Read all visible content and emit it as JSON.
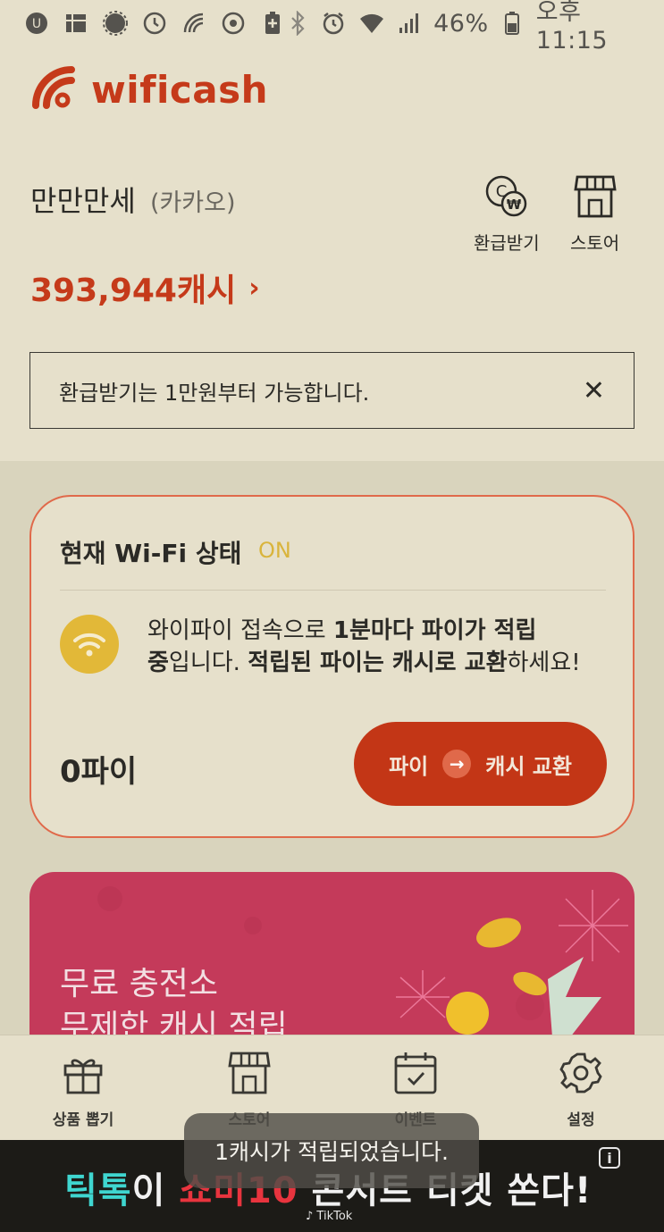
{
  "status_bar": {
    "left_icons": [
      "notification-u-icon",
      "grid-app-icon",
      "badge-icon",
      "clock-app-icon",
      "wifi-app-icon",
      "vpn-icon",
      "battery-saver-icon"
    ],
    "right_icons": [
      "bluetooth-icon",
      "alarm-icon",
      "wifi-icon",
      "signal-icon"
    ],
    "battery": "46%",
    "time": "오후 11:15"
  },
  "app": {
    "logo_text": "wificash"
  },
  "user": {
    "name": "만만만세",
    "provider": "(카카오)"
  },
  "cash": {
    "amount": "393,944캐시",
    "chevron": "›"
  },
  "shortcuts": [
    {
      "label": "환급받기",
      "icon": "refund-coin-icon"
    },
    {
      "label": "스토어",
      "icon": "store-icon"
    }
  ],
  "notice": {
    "text": "환급받기는 1만원부터 가능합니다.",
    "close": "✕"
  },
  "wifi_card": {
    "title": "현재 Wi-Fi 상태",
    "status": "ON",
    "desc_1a": "와이파이 접속으로 ",
    "desc_1b": "1분마다 파이가 적립",
    "desc_2a": "중",
    "desc_2b": "입니다. ",
    "desc_2c": "적립된 파이는 캐시로 교환",
    "desc_2d": "하세요!",
    "pie_count": "0파이",
    "exchange_from": "파이",
    "exchange_to": "캐시 교환"
  },
  "banner": {
    "line1": "무료 충전소",
    "line2": "무제한 캐시 적립"
  },
  "bottom_nav": [
    {
      "label": "상품 뽑기",
      "icon": "gift-icon"
    },
    {
      "label": "스토어",
      "icon": "store-icon"
    },
    {
      "label": "이벤트",
      "icon": "calendar-check-icon"
    },
    {
      "label": "설정",
      "icon": "gear-icon"
    }
  ],
  "ad": {
    "part1": "틱톡",
    "part2": "이 ",
    "part3": "쇼미10",
    "part4": " 콘서트 티켓 쏜다!",
    "source": "♪ TikTok",
    "info": "i"
  },
  "toast": {
    "text": "1캐시가 적립되었습니다."
  },
  "colors": {
    "accent": "#c53a1a",
    "card_border": "#e0694a",
    "on_status": "#d9b43c",
    "banner": "#c43a5a",
    "background": "#e6e0cb"
  }
}
